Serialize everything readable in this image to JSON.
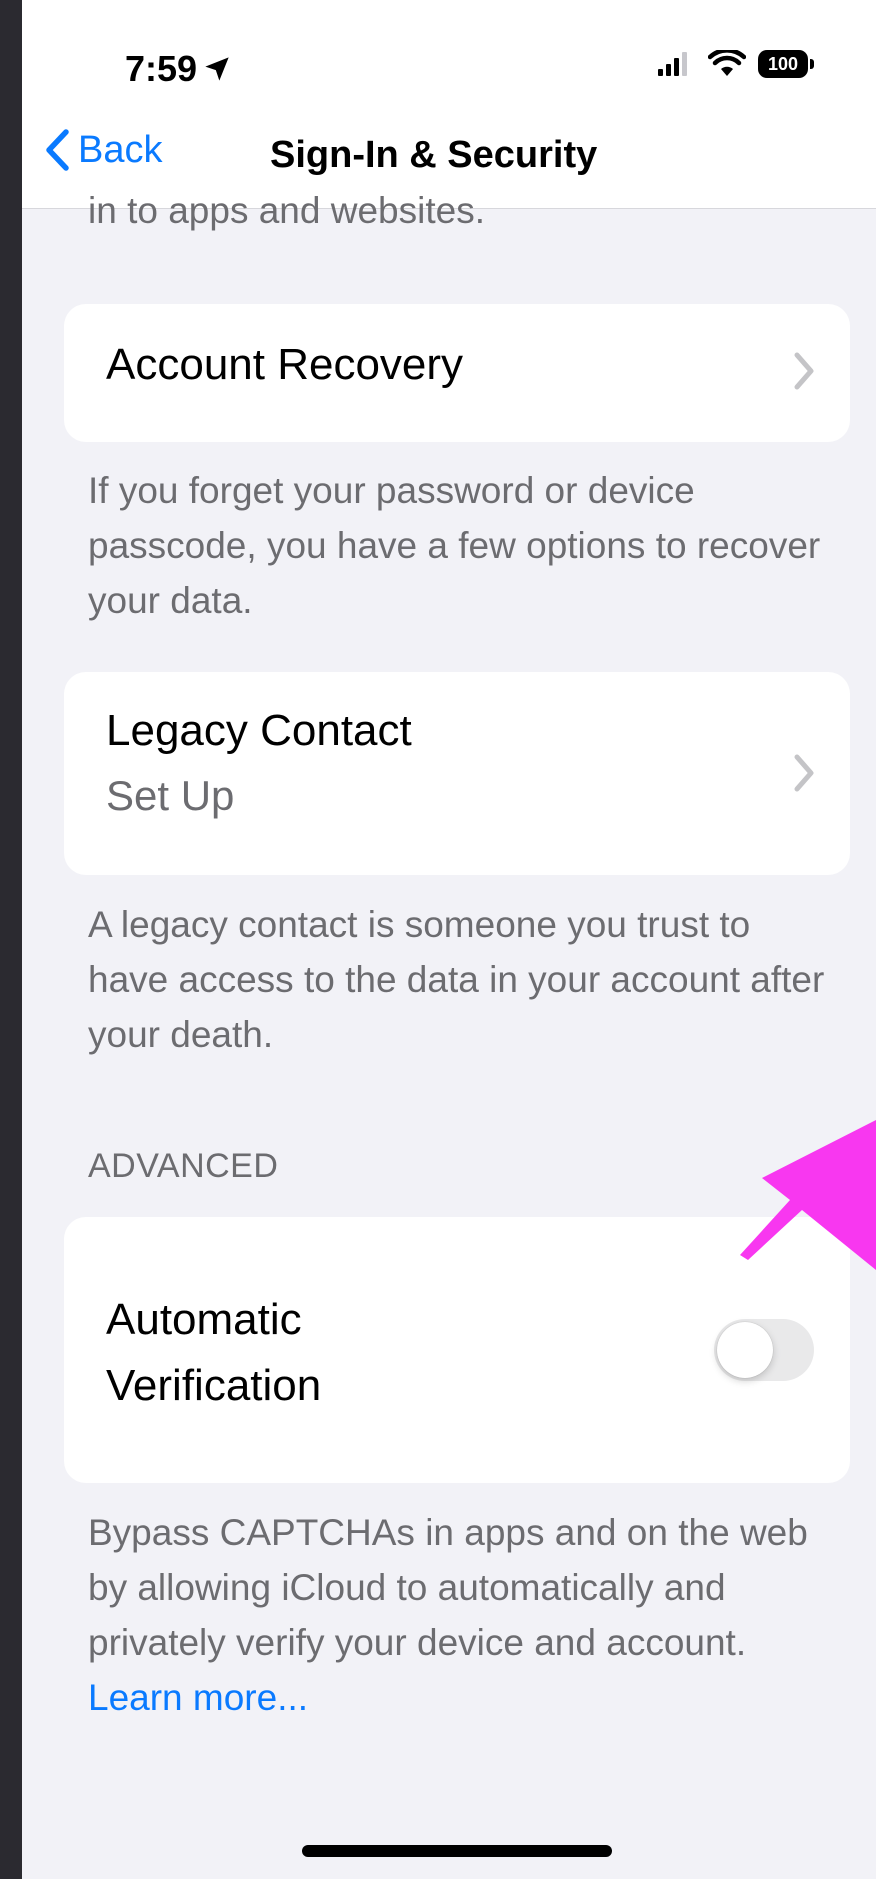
{
  "status_bar": {
    "time": "7:59",
    "battery": "100",
    "icons": [
      "location-arrow-icon",
      "cellular-signal-icon",
      "wifi-icon",
      "battery-icon"
    ]
  },
  "nav": {
    "back_label": "Back",
    "title": "Sign-In & Security"
  },
  "content": {
    "cut_off_text": "in to apps and websites.",
    "account_recovery": {
      "title": "Account Recovery",
      "footnote": "If you forget your password or device passcode, you have a few options to recover your data."
    },
    "legacy_contact": {
      "title": "Legacy Contact",
      "subtitle": "Set Up",
      "footnote": "A legacy contact is someone you trust to have access to the data in your account after your death."
    },
    "advanced": {
      "header": "ADVANCED",
      "automatic_verification": {
        "title_line1": "Automatic",
        "title_line2": "Verification",
        "toggle_on": false
      },
      "footnote": "Bypass CAPTCHAs in apps and on the web by allowing iCloud to automatically and privately verify your device and account. ",
      "learn_more": "Learn more..."
    }
  },
  "colors": {
    "accent": "#0a7aff",
    "background": "#f2f2f7",
    "secondary_text": "#6c6c70",
    "annotation_arrow": "#f837f0"
  }
}
